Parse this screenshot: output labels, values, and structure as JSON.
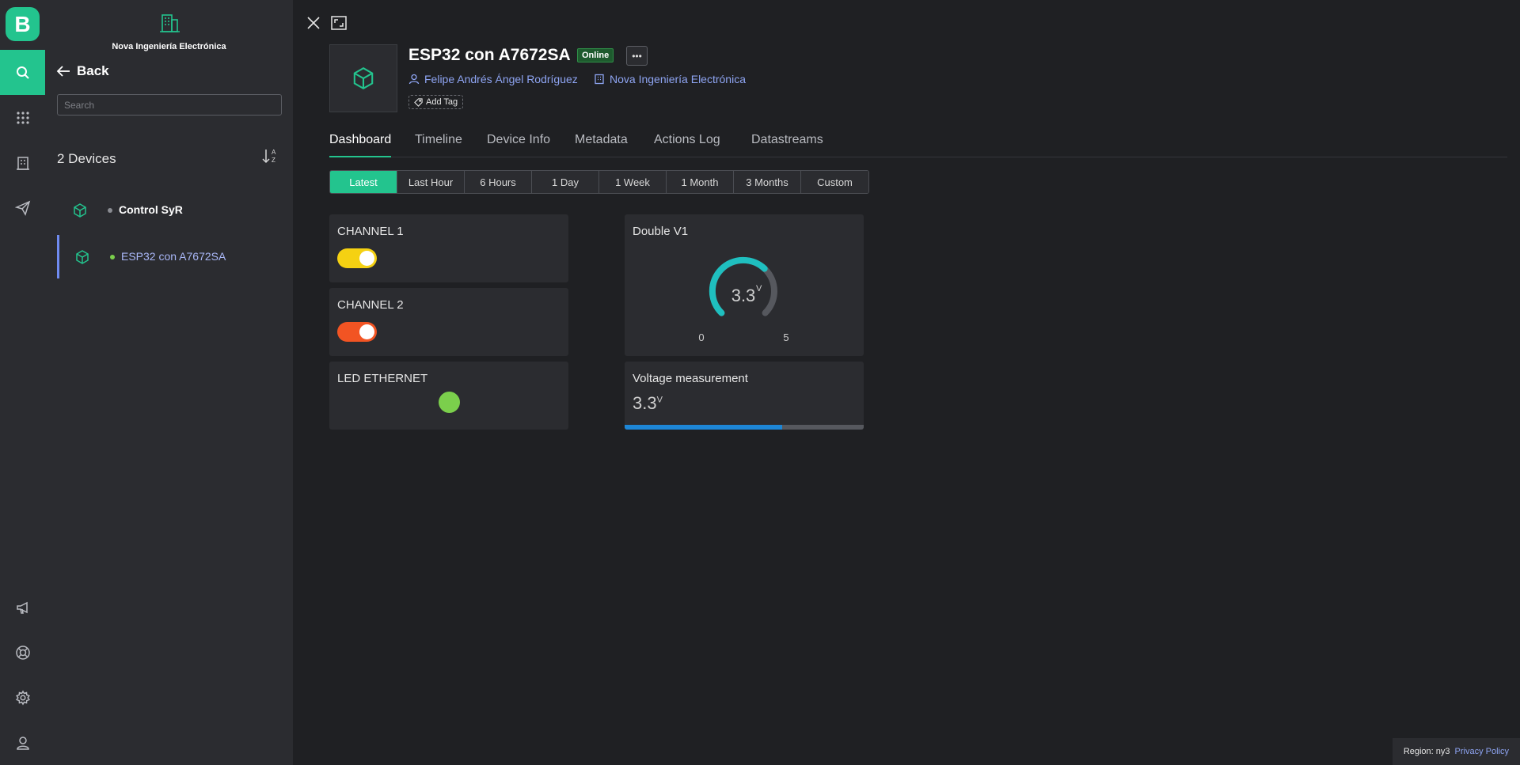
{
  "rail": {
    "logo_letter": "B",
    "items": [
      {
        "name": "search-icon",
        "active": true
      },
      {
        "name": "grid-icon",
        "active": false
      },
      {
        "name": "building-icon",
        "active": false
      },
      {
        "name": "send-icon",
        "active": false
      },
      {
        "name": "megaphone-icon",
        "active": false
      },
      {
        "name": "help-icon",
        "active": false
      },
      {
        "name": "gear-icon",
        "active": false
      },
      {
        "name": "user-icon",
        "active": false
      }
    ]
  },
  "sidebar": {
    "org_name": "Nova Ingeniería Electrónica",
    "back_label": "Back",
    "search_placeholder": "Search",
    "device_count": "2 Devices",
    "devices": [
      {
        "name": "Control SyR",
        "status": "offline",
        "selected": false
      },
      {
        "name": "ESP32 con A7672SA",
        "status": "online",
        "selected": true
      }
    ]
  },
  "device": {
    "title": "ESP32 con A7672SA",
    "status_badge": "Online",
    "more_label": "•••",
    "owner": "Felipe Andrés Ángel Rodríguez",
    "organization": "Nova Ingeniería Electrónica",
    "add_tag": "Add Tag"
  },
  "tabs": [
    "Dashboard",
    "Timeline",
    "Device Info",
    "Metadata",
    "Actions Log",
    "Datastreams"
  ],
  "active_tab": "Dashboard",
  "ranges": [
    "Latest",
    "Last Hour",
    "6 Hours",
    "1 Day",
    "1 Week",
    "1 Month",
    "3 Months",
    "Custom"
  ],
  "active_range": "Latest",
  "widgets": {
    "channel1": {
      "title": "CHANNEL 1",
      "on": true,
      "color": "#f5d112"
    },
    "channel2": {
      "title": "CHANNEL 2",
      "on": true,
      "color": "#f25423"
    },
    "led": {
      "title": "LED ETHERNET",
      "color": "#7bcf4c"
    },
    "gauge": {
      "title": "Double V1",
      "value": "3.3",
      "unit": "V",
      "min": "0",
      "max": "5",
      "fraction": 0.66,
      "color": "#1fbfbf"
    },
    "voltage": {
      "title": "Voltage measurement",
      "value": "3.3",
      "unit": "V",
      "fraction": 0.66,
      "color": "#1d86d6"
    }
  },
  "footer": {
    "region": "Region: ny3",
    "privacy": "Privacy Policy"
  },
  "colors": {
    "accent": "#23c48e",
    "link": "#8ea4f2",
    "background": "#1f2023",
    "panel": "#2b2c30"
  }
}
